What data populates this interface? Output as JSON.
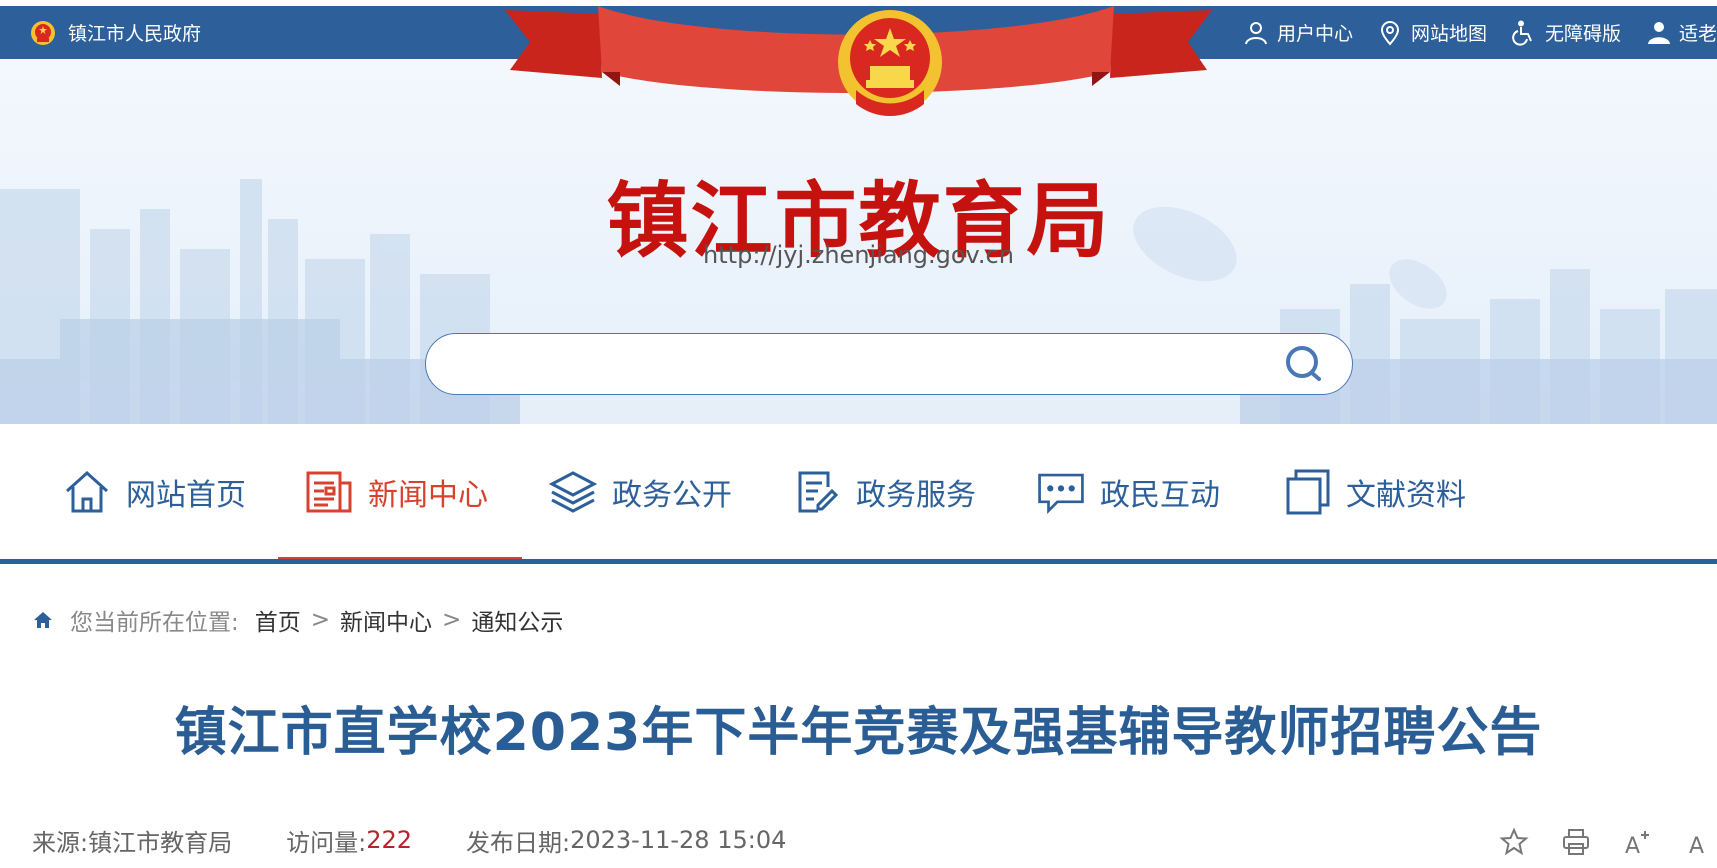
{
  "topbar": {
    "gov_link": "镇江市人民政府",
    "utilities": [
      {
        "icon": "user-icon",
        "label": "用户中心"
      },
      {
        "icon": "location-pin-icon",
        "label": "网站地图"
      },
      {
        "icon": "wheelchair-icon",
        "label": "无障碍版"
      },
      {
        "icon": "elder-mode-icon",
        "label": "适老"
      }
    ]
  },
  "header": {
    "title": "镇江市教育局",
    "url": "http://jyj.zhenjiang.gov.cn",
    "search_placeholder": ""
  },
  "nav": {
    "items": [
      {
        "icon": "home-icon",
        "label": "网站首页",
        "active": false
      },
      {
        "icon": "newspaper-icon",
        "label": "新闻中心",
        "active": true
      },
      {
        "icon": "layers-icon",
        "label": "政务公开",
        "active": false
      },
      {
        "icon": "document-edit-icon",
        "label": "政务服务",
        "active": false
      },
      {
        "icon": "chat-icon",
        "label": "政民互动",
        "active": false
      },
      {
        "icon": "copy-icon",
        "label": "文献资料",
        "active": false
      }
    ]
  },
  "breadcrumb": {
    "prefix": "您当前所在位置:",
    "items": [
      "首页",
      "新闻中心",
      "通知公示"
    ],
    "separator": ">"
  },
  "article": {
    "title": "镇江市直学校2023年下半年竞赛及强基辅导教师招聘公告",
    "source_label": "来源:",
    "source": "镇江市教育局",
    "views_label": "访问量:",
    "views": "222",
    "date_label": "发布日期:",
    "date": "2023-11-28 15:04"
  },
  "tools": [
    {
      "icon": "star-icon"
    },
    {
      "icon": "print-icon"
    },
    {
      "icon": "font-increase-icon",
      "label": "A"
    },
    {
      "icon": "font-decrease-icon",
      "label": "A"
    }
  ],
  "colors": {
    "primary_blue": "#2d5f9a",
    "title_red": "#c5120f",
    "active_red": "#d9412f",
    "article_title_blue": "#2b5d95"
  }
}
